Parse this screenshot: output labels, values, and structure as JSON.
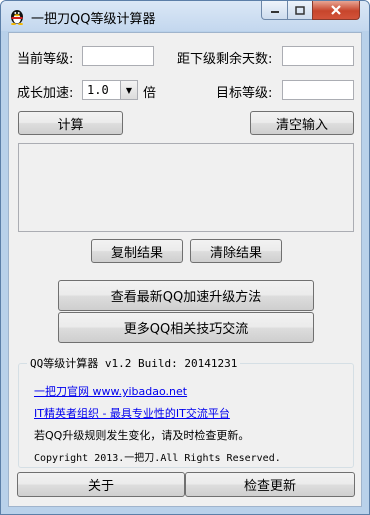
{
  "window": {
    "title": "一把刀QQ等级计算器",
    "buttons": {
      "minimize": "minimize-icon",
      "maximize": "maximize-icon",
      "close": "close-icon"
    }
  },
  "form": {
    "current_level_label": "当前等级:",
    "current_level_value": "",
    "days_remaining_label": "距下级剩余天数:",
    "days_remaining_value": "",
    "growth_speed_label": "成长加速:",
    "growth_speed_value": "1.0",
    "growth_speed_unit": "倍",
    "target_level_label": "目标等级:",
    "target_level_value": ""
  },
  "actions": {
    "calculate": "计算",
    "clear_input": "清空输入",
    "copy_result": "复制结果",
    "clear_result": "清除结果",
    "view_speedup": "查看最新QQ加速升级方法",
    "more_tips": "更多QQ相关技巧交流"
  },
  "result": {
    "text": ""
  },
  "info": {
    "group_title": "QQ等级计算器 v1.2 Build: 20141231",
    "site_link": "一把刀官网 www.yibadao.net",
    "org_link": "IT精英者组织 - 最具专业性的IT交流平台",
    "notice": "若QQ升级规则发生变化，请及时检查更新。",
    "copyright": "Copyright 2013.一把刀.All Rights Reserved."
  },
  "footer": {
    "about": "关于",
    "check_update": "检查更新"
  },
  "colors": {
    "titlebar": "#c3d7ee",
    "close_button": "#c7452c",
    "link": "#0000ee",
    "client_bg": "#f0f0f0"
  }
}
